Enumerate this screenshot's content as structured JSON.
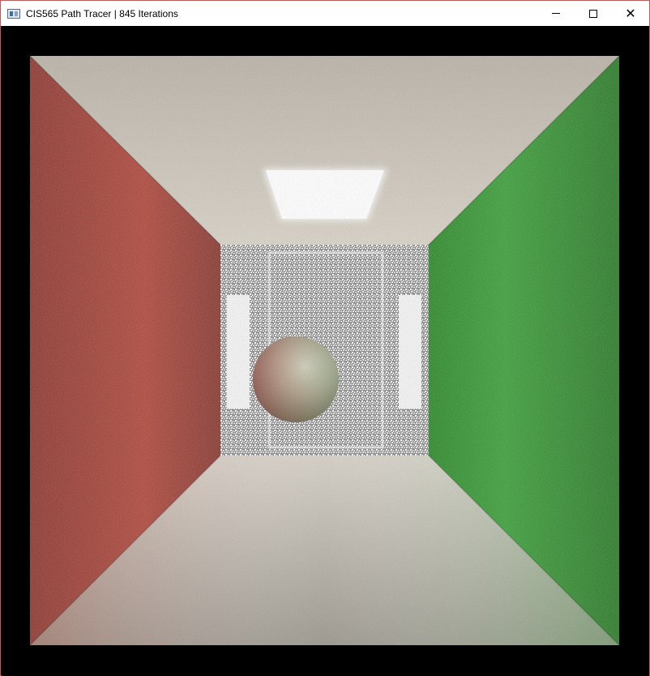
{
  "window": {
    "title": "CIS565 Path Tracer | 845 Iterations",
    "controls": [
      "minimize",
      "maximize",
      "close"
    ]
  },
  "icons": {
    "app": "app-window-icon",
    "minimize": "minimize-icon",
    "maximize": "maximize-icon",
    "close": "close-icon"
  },
  "scene": {
    "description_free": true,
    "colors": {
      "left_wall": "#a84a40",
      "right_wall": "#3d9a3a",
      "ceiling": "#c7c0b4",
      "floor": "#b7b2a8",
      "back_wall": "#e8e8e8",
      "light": "#ffffff",
      "background": "#000000"
    }
  }
}
